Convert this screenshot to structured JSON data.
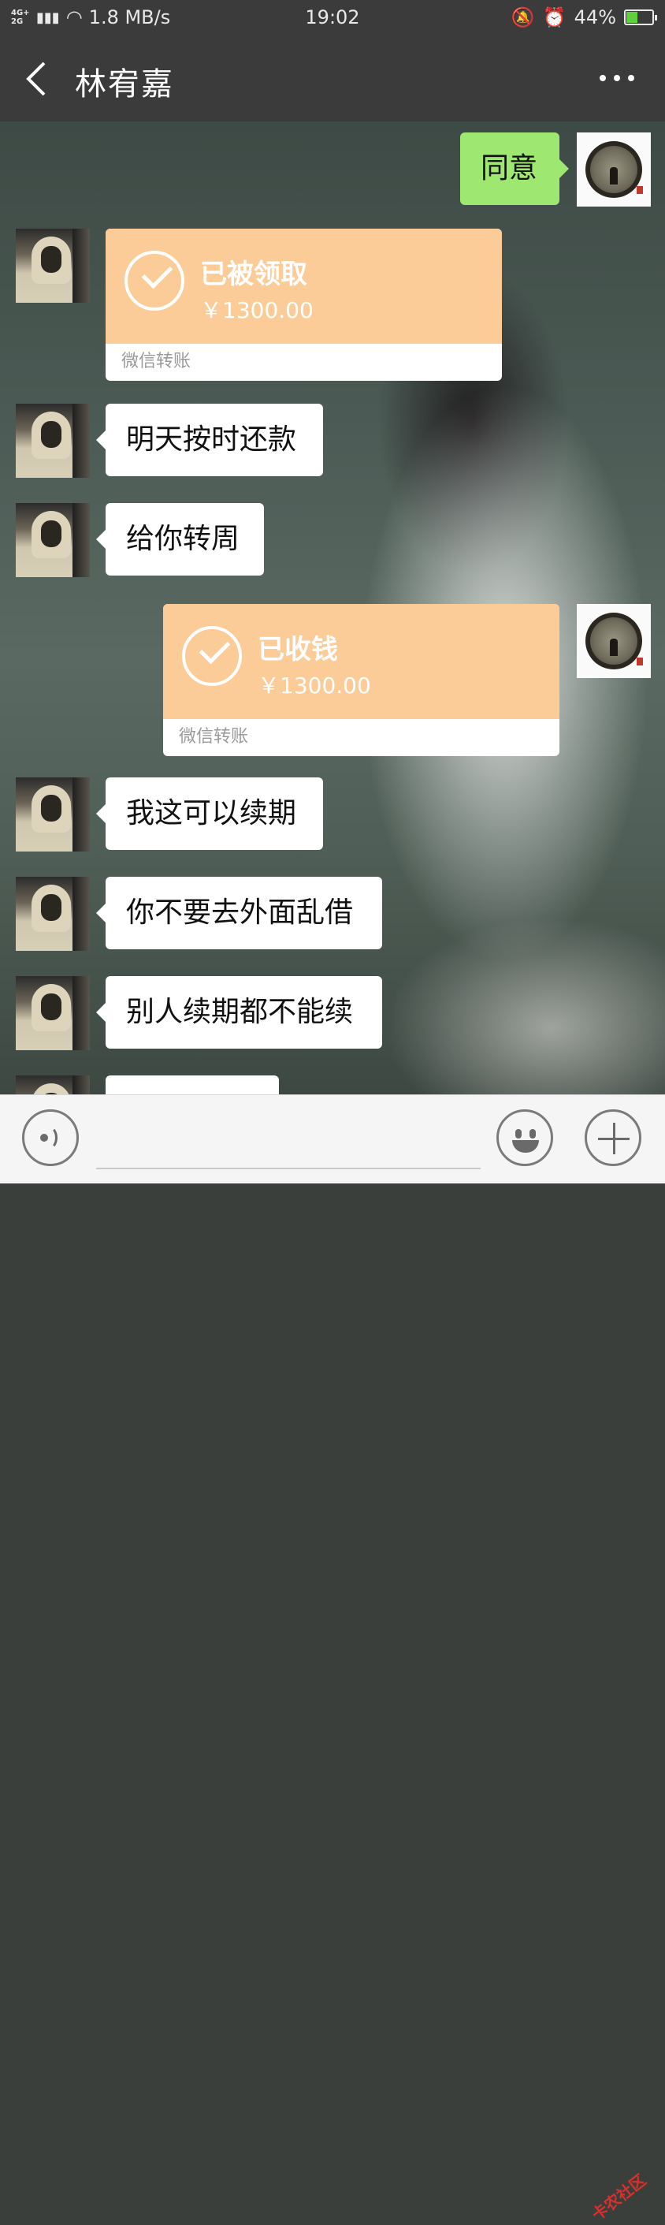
{
  "status_bar": {
    "network": "4G+ 2G",
    "speed": "1.8 MB/s",
    "time": "19:02",
    "battery": "44%",
    "battery_level": 0.44
  },
  "header": {
    "title": "林宥嘉"
  },
  "messages": [
    {
      "side": "right",
      "type": "text",
      "text": "同意"
    },
    {
      "side": "left",
      "type": "transfer",
      "status": "已被领取",
      "amount": "￥1300.00",
      "footer": "微信转账"
    },
    {
      "side": "left",
      "type": "text",
      "text": "明天按时还款"
    },
    {
      "side": "left",
      "type": "text",
      "text": "给你转周"
    },
    {
      "side": "right",
      "type": "transfer",
      "status": "已收钱",
      "amount": "￥1300.00",
      "footer": "微信转账"
    },
    {
      "side": "left",
      "type": "text",
      "text": "我这可以续期"
    },
    {
      "side": "left",
      "type": "text",
      "text": "你不要去外面乱借"
    },
    {
      "side": "left",
      "type": "text",
      "text": "别人续期都不能续"
    },
    {
      "side": "left",
      "type": "text",
      "text": ""
    }
  ],
  "input_bar": {
    "voice_icon": "voice-icon",
    "emoji_icon": "emoji-icon",
    "plus_icon": "plus-icon"
  },
  "watermark": "卡农社区",
  "colors": {
    "bar": "#3b3b3b",
    "sent_bubble": "#9ee871",
    "transfer": "#fbcc97"
  }
}
